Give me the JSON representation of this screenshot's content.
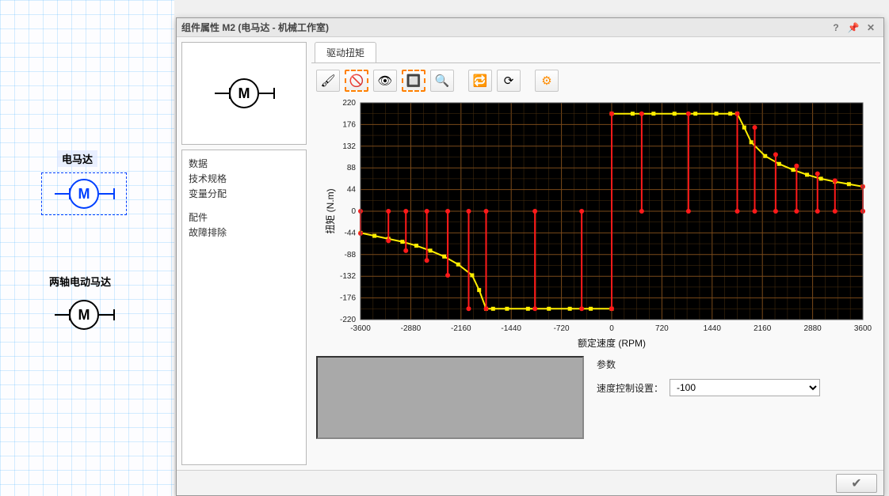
{
  "canvas": {
    "label1": "电马达",
    "label2": "两轴电动马达",
    "motor_letter": "M"
  },
  "dialog": {
    "title": "组件属性 M2 (电马达 - 机械工作室)"
  },
  "tree": {
    "items": [
      "数据",
      "技术规格",
      "变量分配",
      "配件",
      "故障排除"
    ]
  },
  "tabs": {
    "active": "驱动扭矩"
  },
  "toolbar": {
    "icons": [
      "brush",
      "eye-off",
      "eye",
      "zoom-box",
      "zoom",
      "refresh-pair",
      "refresh",
      "gear"
    ]
  },
  "params": {
    "section": "参数",
    "speed_label": "速度控制设置：",
    "speed_value": "-100"
  },
  "chart_data": {
    "type": "line",
    "title": "",
    "xlabel": "额定速度 (RPM)",
    "ylabel": "扭矩 (N.m)",
    "xlim": [
      -3600,
      3600
    ],
    "ylim": [
      -220,
      220
    ],
    "xticks": [
      -3600,
      -2880,
      -2160,
      -1440,
      -720,
      0,
      720,
      1440,
      2160,
      2880,
      3600
    ],
    "yticks": [
      -220,
      -176,
      -132,
      -88,
      -44,
      0,
      44,
      88,
      132,
      176,
      220
    ],
    "series": [
      {
        "name": "yellow-curve",
        "color": "#ffee00",
        "points": [
          [
            -3600,
            -44
          ],
          [
            -3400,
            -50
          ],
          [
            -3200,
            -56
          ],
          [
            -3000,
            -62
          ],
          [
            -2800,
            -70
          ],
          [
            -2600,
            -80
          ],
          [
            -2400,
            -92
          ],
          [
            -2200,
            -108
          ],
          [
            -2000,
            -130
          ],
          [
            -1900,
            -160
          ],
          [
            -1800,
            -198
          ],
          [
            -1700,
            -198
          ],
          [
            -1500,
            -198
          ],
          [
            -1200,
            -198
          ],
          [
            -900,
            -198
          ],
          [
            -600,
            -198
          ],
          [
            -300,
            -198
          ],
          [
            0,
            -198
          ],
          [
            0,
            198
          ],
          [
            300,
            198
          ],
          [
            600,
            198
          ],
          [
            900,
            198
          ],
          [
            1200,
            198
          ],
          [
            1500,
            198
          ],
          [
            1700,
            198
          ],
          [
            1800,
            198
          ],
          [
            1900,
            170
          ],
          [
            2000,
            140
          ],
          [
            2200,
            112
          ],
          [
            2400,
            96
          ],
          [
            2600,
            84
          ],
          [
            2800,
            74
          ],
          [
            3000,
            66
          ],
          [
            3200,
            60
          ],
          [
            3400,
            55
          ],
          [
            3600,
            50
          ]
        ]
      },
      {
        "name": "red-stems",
        "color": "#ff1a1a",
        "stems": [
          [
            -3600,
            0,
            -45
          ],
          [
            -3200,
            0,
            -60
          ],
          [
            -2950,
            0,
            -80
          ],
          [
            -2650,
            0,
            -100
          ],
          [
            -2350,
            0,
            -130
          ],
          [
            -2050,
            0,
            -198
          ],
          [
            -1800,
            0,
            -198
          ],
          [
            -1100,
            0,
            -198
          ],
          [
            -430,
            0,
            -198
          ],
          [
            0,
            -198,
            198
          ],
          [
            430,
            0,
            198
          ],
          [
            1100,
            0,
            198
          ],
          [
            1800,
            0,
            198
          ],
          [
            2050,
            0,
            170
          ],
          [
            2350,
            0,
            115
          ],
          [
            2650,
            0,
            92
          ],
          [
            2950,
            0,
            76
          ],
          [
            3200,
            0,
            62
          ],
          [
            3600,
            0,
            50
          ],
          [
            3600,
            0,
            0
          ]
        ]
      }
    ]
  }
}
